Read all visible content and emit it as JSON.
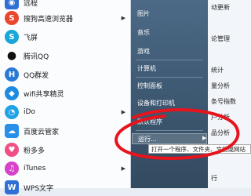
{
  "programs": [
    {
      "label": "远程",
      "icon": "remote-icon",
      "color": "#2f6fd6",
      "glyph": "◉"
    },
    {
      "label": "搜狗高速浏览器",
      "icon": "sogou-browser-icon",
      "color": "#e9462b",
      "glyph": "S",
      "arrow": "▶"
    },
    {
      "label": "飞屏",
      "icon": "feiping-icon",
      "color": "#18a7d8",
      "glyph": "S"
    },
    {
      "label": "腾讯QQ",
      "icon": "qq-penguin-icon",
      "color": "#222222",
      "glyph": "●"
    },
    {
      "label": "QQ群发",
      "icon": "qq-mass-send-icon",
      "color": "#2b79d6",
      "glyph": "H"
    },
    {
      "label": "wifi共享精灵",
      "icon": "wifi-icon",
      "color": "#1e8be0",
      "glyph": "◆"
    },
    {
      "label": "iDo",
      "icon": "ido-icon",
      "color": "#1fa3e6",
      "glyph": "◔",
      "arrow": "▶"
    },
    {
      "label": "百度云管家",
      "icon": "baidu-cloud-icon",
      "color": "#2a8fe8",
      "glyph": "☁"
    },
    {
      "label": "粉多多",
      "icon": "fenduoduo-icon",
      "color": "#f04f86",
      "glyph": "♥"
    },
    {
      "label": "iTunes",
      "icon": "itunes-icon",
      "color": "#d642c8",
      "glyph": "♫",
      "arrow": "▶"
    },
    {
      "label": "WPS文字",
      "icon": "wps-icon",
      "color": "#2f6fd6",
      "glyph": "W"
    }
  ],
  "right_menu": [
    {
      "label": "图片"
    },
    {
      "label": "音乐"
    },
    {
      "label": "游戏"
    },
    {
      "label": "计算机"
    },
    {
      "label": "控制面板"
    },
    {
      "label": "设备和打印机"
    },
    {
      "label": "默认程序"
    },
    {
      "label": "运行..."
    }
  ],
  "background_app": [
    "动更新",
    "论管理",
    "统计",
    "量分析",
    "条号指数",
    "户分析",
    "品分析",
    "用户",
    "行"
  ],
  "tooltip": "打开一个程序、文件夹、文档或网站"
}
